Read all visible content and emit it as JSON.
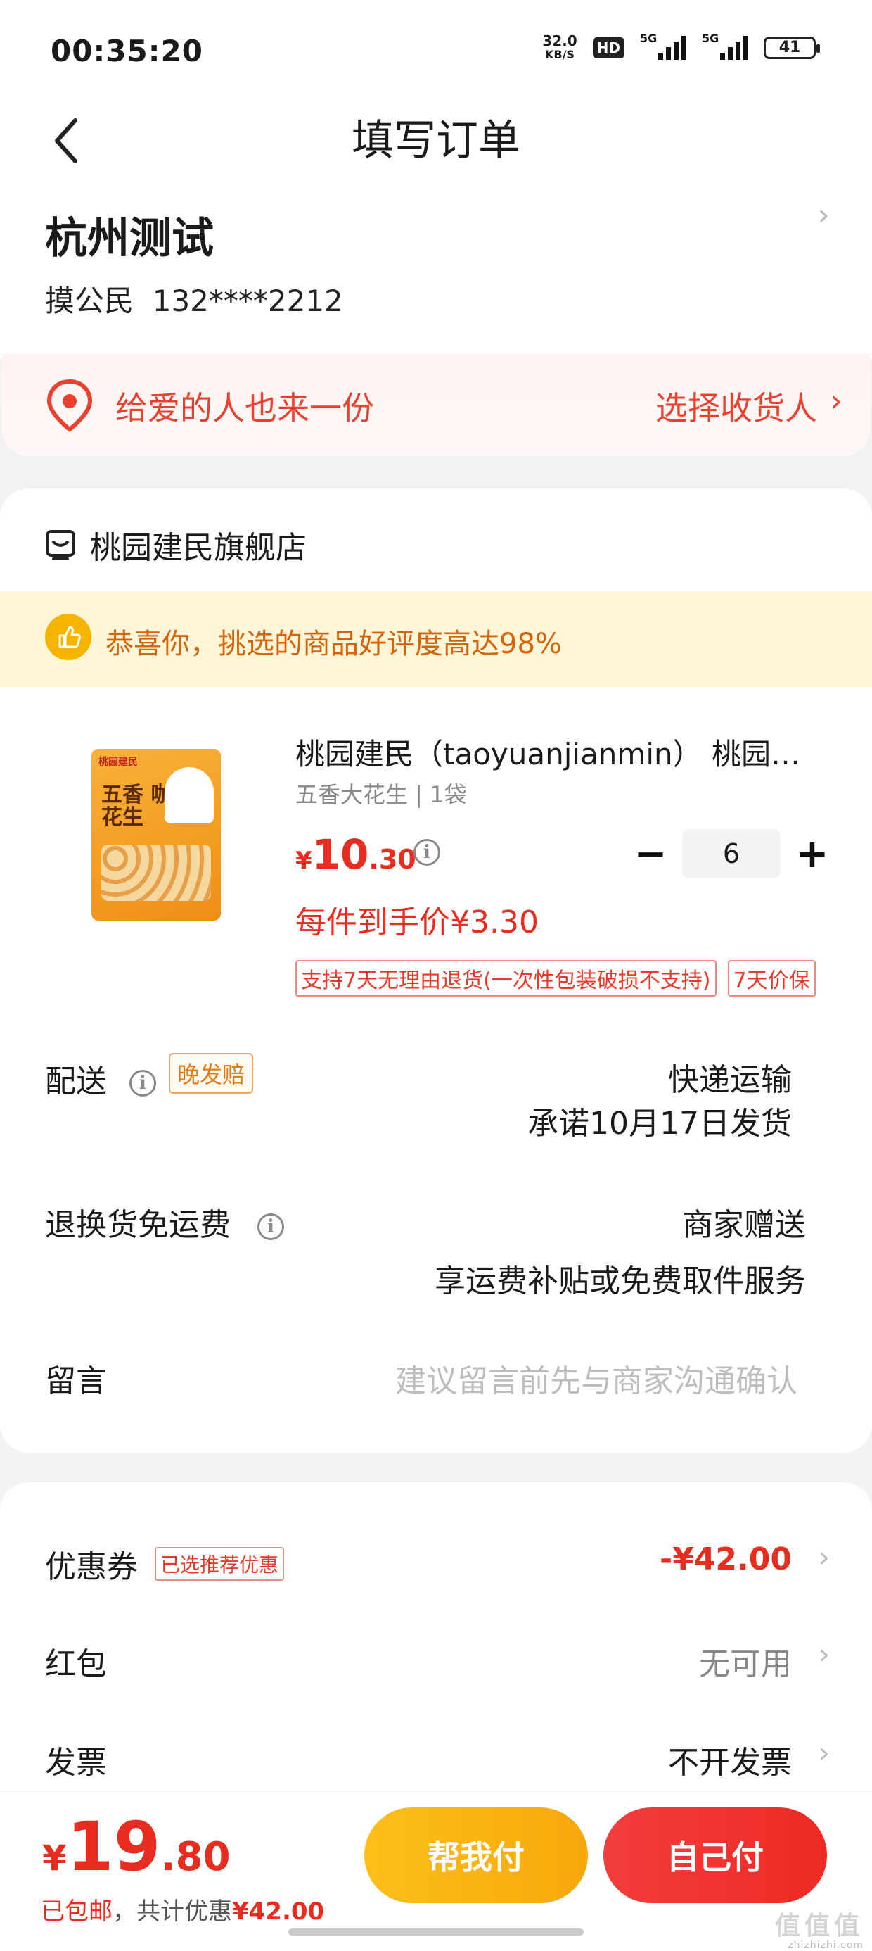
{
  "status_bar": {
    "time": "00:35:20",
    "net_speed_value": "32.0",
    "net_speed_unit": "KB/S",
    "hd_label": "HD",
    "sim1": "5G",
    "sim2": "5G",
    "battery": "41"
  },
  "header": {
    "title": "填写订单"
  },
  "address": {
    "name": "杭州测试",
    "recipient": "摸公民",
    "phone": "132****2212",
    "gift_text": "给爱的人也来一份",
    "gift_action": "选择收货人"
  },
  "store": {
    "name": "桃园建民旗舰店",
    "promo": "恭喜你，挑选的商品好评度高达98%"
  },
  "product": {
    "image_text_brand": "桃园建民",
    "image_text_name": "五香 咖喱大花生",
    "title": "桃园建民（taoyuanjianmin） 桃园建民五香大花生",
    "spec": "五香大花生 | 1袋",
    "price_currency": "¥",
    "price_int": "10",
    "price_dec": ".30",
    "quantity": "6",
    "minus_label": "−",
    "plus_label": "+",
    "deal_price": "每件到手价¥3.30",
    "tags": [
      "支持7天无理由退货(一次性包装破损不支持)",
      "7天价保"
    ]
  },
  "delivery": {
    "label": "配送",
    "badge": "晚发赔",
    "method": "快递运输",
    "promise": "承诺10月17日发货"
  },
  "return_shipping": {
    "label": "退换货免运费",
    "value": "商家赠送",
    "desc": "享运费补贴或免费取件服务"
  },
  "remark": {
    "label": "留言",
    "placeholder": "建议留言前先与商家沟通确认"
  },
  "coupon": {
    "label": "优惠券",
    "tag": "已选推荐优惠",
    "value": "-¥42.00"
  },
  "red_packet": {
    "label": "红包",
    "value": "无可用"
  },
  "invoice": {
    "label": "发票",
    "value": "不开发票"
  },
  "bottom": {
    "currency": "¥",
    "total_int": "19",
    "total_dec": ".80",
    "free_ship": "已包邮",
    "discount_label": "，共计优惠",
    "discount_amount": "¥42.00",
    "pay_for_me": "帮我付",
    "pay_self": "自己付",
    "watermark": "值值值",
    "watermark_url": "zhizhizhi.com"
  },
  "colors": {
    "accent_red": "#e62d1f",
    "pay_yellow": "#fcbf1b",
    "pay_red": "#f23d3d",
    "promo_orange": "#d5650c"
  }
}
